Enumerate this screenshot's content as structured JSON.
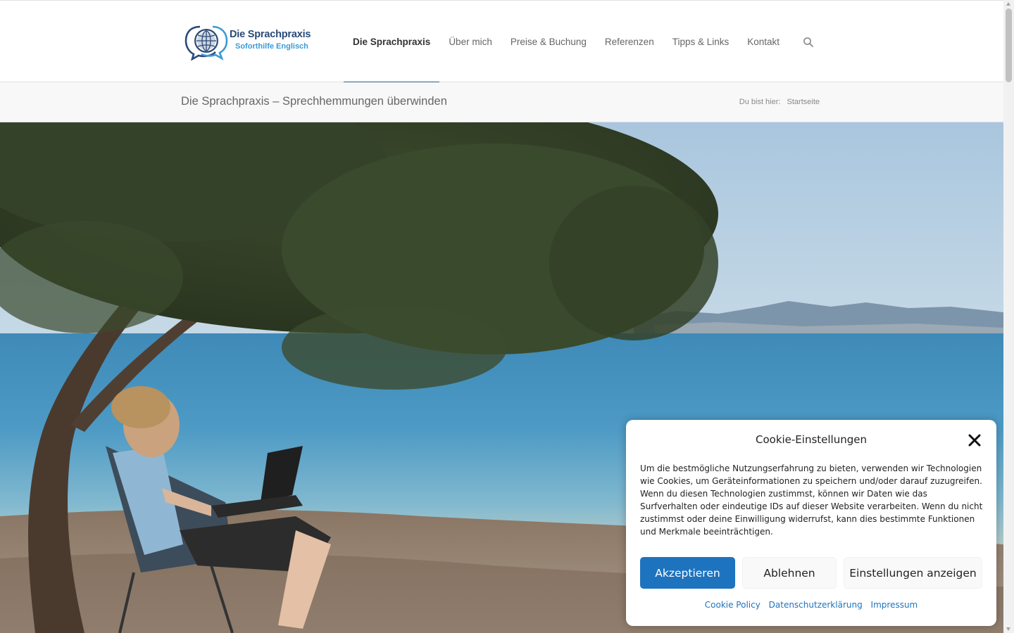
{
  "header": {
    "logo": {
      "title": "Die Sprachpraxis",
      "subtitle": "Soforthilfe Englisch"
    },
    "nav": [
      {
        "label": "Die Sprachpraxis",
        "active": true
      },
      {
        "label": "Über mich",
        "active": false
      },
      {
        "label": "Preise & Buchung",
        "active": false
      },
      {
        "label": "Referenzen",
        "active": false
      },
      {
        "label": "Tipps & Links",
        "active": false
      },
      {
        "label": "Kontakt",
        "active": false
      }
    ],
    "search_icon": "search-icon"
  },
  "title_bar": {
    "title": "Die Sprachpraxis – Sprechhemmungen überwinden",
    "breadcrumb_prefix": "Du bist hier:",
    "breadcrumb_current": "Startseite"
  },
  "cookie_banner": {
    "title": "Cookie-Einstellungen",
    "text": "Um die bestmögliche Nutzungserfahrung zu bieten, verwenden wir Technologien wie Cookies, um Geräteinformationen zu speichern und/oder darauf zuzugreifen. Wenn du diesen Technologien zustimmst, können wir Daten wie das Surfverhalten oder eindeutige IDs auf dieser Website verarbeiten. Wenn du nicht zustimmst oder deine Einwilligung widerrufst, kann dies bestimmte Funktionen und Merkmale beeinträchtigen.",
    "accept_label": "Akzeptieren",
    "deny_label": "Ablehnen",
    "prefs_label": "Einstellungen anzeigen",
    "links": {
      "cookie_policy": "Cookie Policy",
      "privacy": "Datenschutzerklärung",
      "imprint": "Impressum"
    }
  },
  "colors": {
    "brand_dark": "#2a4a78",
    "brand_light": "#3a9bd6",
    "accent": "#1e73be",
    "active_underline": "#2a5d8f"
  }
}
